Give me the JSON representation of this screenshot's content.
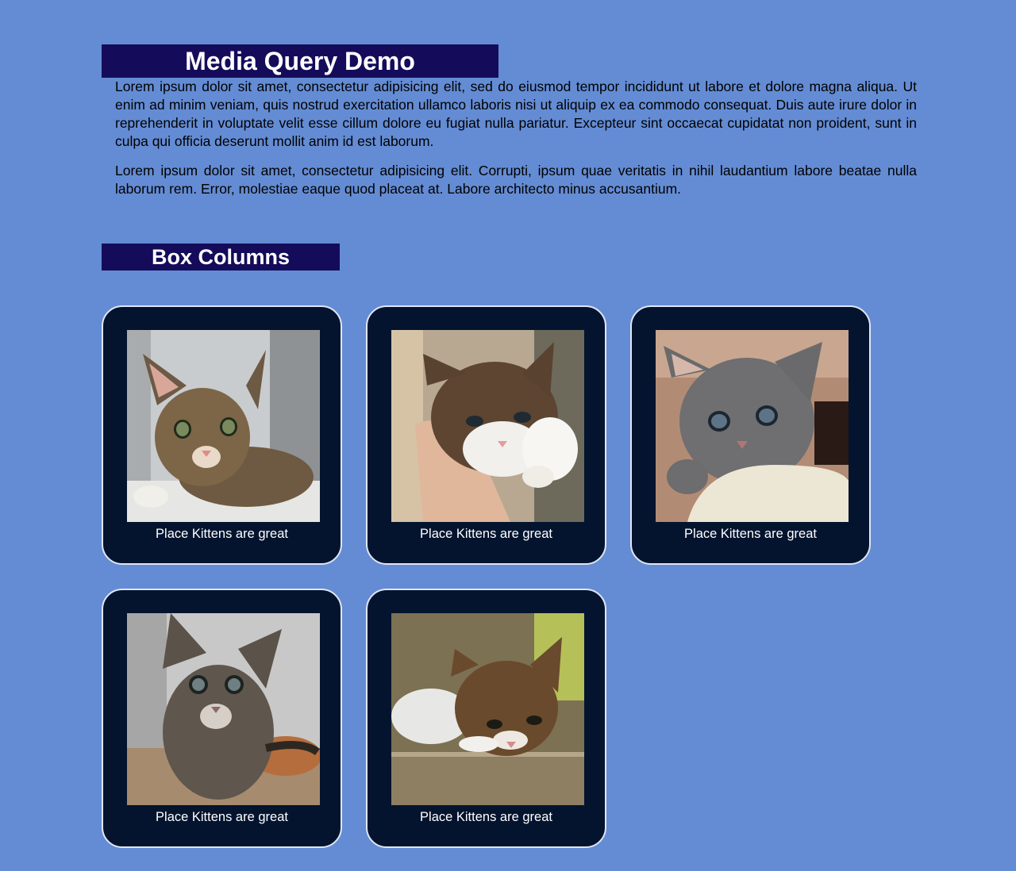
{
  "header": {
    "title": "Media Query Demo"
  },
  "intro": {
    "paragraphs": [
      "Lorem ipsum dolor sit amet, consectetur adipisicing elit, sed do eiusmod tempor incididunt ut labore et dolore magna aliqua. Ut enim ad minim veniam, quis nostrud exercitation ullamco laboris nisi ut aliquip ex ea commodo consequat. Duis aute irure dolor in reprehenderit in voluptate velit esse cillum dolore eu fugiat nulla pariatur. Excepteur sint occaecat cupidatat non proident, sunt in culpa qui officia deserunt mollit anim id est laborum.",
      "Lorem ipsum dolor sit amet, consectetur adipisicing elit. Corrupti, ipsum quae veritatis in nihil laudantium labore beatae nulla laborum rem. Error, molestiae eaque quod placeat at. Labore architecto minus accusantium."
    ]
  },
  "section": {
    "title": "Box Columns"
  },
  "cards": [
    {
      "caption": "Place Kittens are great",
      "image": "kitten-photo-tabby-lying"
    },
    {
      "caption": "Place Kittens are great",
      "image": "kitten-photo-held-in-hand"
    },
    {
      "caption": "Place Kittens are great",
      "image": "kitten-photo-grey-fluffy"
    },
    {
      "caption": "Place Kittens are great",
      "image": "kitten-photo-tabby-sitting"
    },
    {
      "caption": "Place Kittens are great",
      "image": "kitten-photo-peeking"
    }
  ],
  "colors": {
    "background": "#648cd4",
    "heading": "#140c5a",
    "card": "#04142e",
    "card_border": "#dfe6f5"
  }
}
